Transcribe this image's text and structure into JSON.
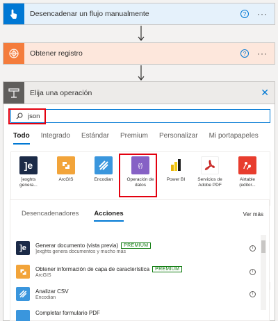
{
  "steps": [
    {
      "title": "Desencadenar un flujo manualmente",
      "help": "?",
      "more": "···"
    },
    {
      "title": "Obtener registro",
      "help": "?",
      "more": "···"
    }
  ],
  "panel": {
    "title": "Elija una operación",
    "close": "✕",
    "search_value": "json",
    "tabs": [
      "Todo",
      "Integrado",
      "Estándar",
      "Premium",
      "Personalizar",
      "Mi portapapeles"
    ],
    "connectors": [
      {
        "l1": "]exghts",
        "l2": "genera...",
        "icon": "jexghts-icon",
        "color": "#1b2a47"
      },
      {
        "l1": "ArcGIS",
        "l2": "",
        "icon": "arcgis-icon",
        "color": "#f2a43a"
      },
      {
        "l1": "Encodian",
        "l2": "",
        "icon": "encodian-icon",
        "color": "#3a96dd"
      },
      {
        "l1": "Operación de",
        "l2": "datos",
        "icon": "data-operation-icon",
        "color": "#8661c5"
      },
      {
        "l1": "Power BI",
        "l2": "",
        "icon": "powerbi-icon",
        "color": "#f2c811"
      },
      {
        "l1": "Servicios de",
        "l2": "Adobe PDF",
        "icon": "adobe-pdf-icon",
        "color": "#c7221f"
      },
      {
        "l1": "Airtable",
        "l2": "(editor...",
        "icon": "airtable-icon",
        "color": "#e83d2e"
      }
    ],
    "action_tabs": [
      "Desencadenadores",
      "Acciones"
    ],
    "see_more": "Ver más",
    "actions": [
      {
        "name": "Generar documento (vista previa)",
        "badge": "PREMIUM",
        "sub": "]exghts genera documentos y mucho más",
        "icon": "jexghts-icon",
        "color": "#1b2a47"
      },
      {
        "name": "Obtener información de capa de característica",
        "badge": "PREMIUM",
        "sub": "ArcGIS",
        "icon": "arcgis-icon",
        "color": "#f2a43a"
      },
      {
        "name": "Analizar CSV",
        "badge": "",
        "sub": "Encodian",
        "icon": "encodian-icon",
        "color": "#3a96dd"
      },
      {
        "name": "Completar formulario PDF",
        "badge": "",
        "sub": "",
        "icon": "encodian-icon",
        "color": "#3a96dd"
      }
    ]
  },
  "colors": {
    "accent": "#0078d4",
    "highlight": "#e3000f",
    "premium": "#107c10",
    "trigger_blue": "#0078d4",
    "http_orange": "#f47c3c"
  }
}
